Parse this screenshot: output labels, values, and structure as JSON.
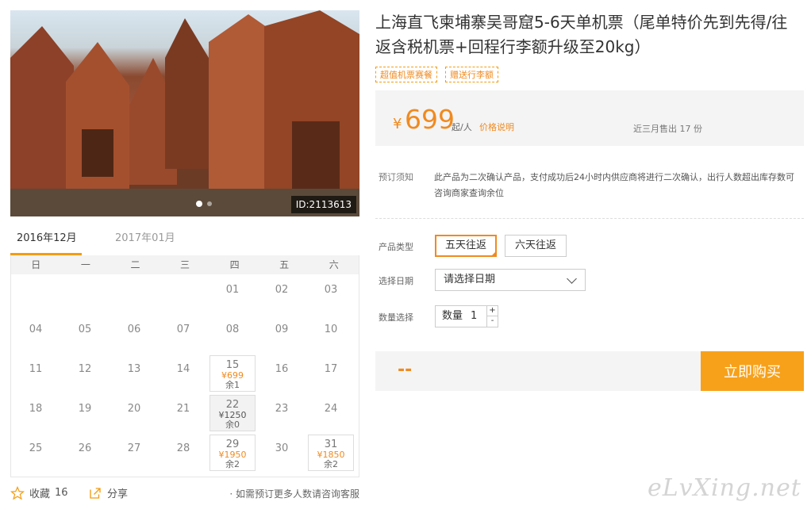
{
  "product": {
    "title": "上海直飞柬埔寨吴哥窟5-6天单机票（尾单特价先到先得/往返含税机票+回程行李额升级至20kg）",
    "tags": [
      "超值机票赛餐",
      "赠送行李额"
    ],
    "image_id": "ID:2113613"
  },
  "price": {
    "currency": "¥",
    "amount": "699",
    "unit": "起/人",
    "note_link": "价格说明",
    "sold": "近三月售出 17 份"
  },
  "notice": {
    "label": "预订须知",
    "text": "此产品为二次确认产品，支付成功后24小时内供应商将进行二次确认，出行人数超出库存数可咨询商家查询余位"
  },
  "options": {
    "type_label": "产品类型",
    "types": [
      "五天往返",
      "六天往返"
    ],
    "date_label": "选择日期",
    "date_placeholder": "请选择日期",
    "qty_label": "数量选择",
    "qty_field_label": "数量",
    "qty_value": "1",
    "plus": "+",
    "minus": "-"
  },
  "buy": {
    "total": "--",
    "button": "立即购买"
  },
  "calendar": {
    "tabs": [
      "2016年12月",
      "2017年01月"
    ],
    "weekdays": [
      "日",
      "一",
      "二",
      "三",
      "四",
      "五",
      "六"
    ],
    "weeks": [
      [
        null,
        null,
        null,
        null,
        {
          "d": "01"
        },
        {
          "d": "02"
        },
        {
          "d": "03"
        }
      ],
      [
        {
          "d": "04"
        },
        {
          "d": "05"
        },
        {
          "d": "06"
        },
        {
          "d": "07"
        },
        {
          "d": "08"
        },
        {
          "d": "09"
        },
        {
          "d": "10"
        }
      ],
      [
        {
          "d": "11"
        },
        {
          "d": "12"
        },
        {
          "d": "13"
        },
        {
          "d": "14"
        },
        {
          "d": "15",
          "p": "¥699",
          "r": "余1"
        },
        {
          "d": "16"
        },
        {
          "d": "17"
        }
      ],
      [
        {
          "d": "18"
        },
        {
          "d": "19"
        },
        {
          "d": "20"
        },
        {
          "d": "21"
        },
        {
          "d": "22",
          "p": "¥1250",
          "r": "余0",
          "dark": true
        },
        {
          "d": "23"
        },
        {
          "d": "24"
        }
      ],
      [
        {
          "d": "25"
        },
        {
          "d": "26"
        },
        {
          "d": "27"
        },
        {
          "d": "28"
        },
        {
          "d": "29",
          "p": "¥1950",
          "r": "余2"
        },
        {
          "d": "30"
        },
        {
          "d": "31",
          "p": "¥1850",
          "r": "余2"
        }
      ]
    ]
  },
  "footer": {
    "favorite_label": "收藏",
    "favorite_count": "16",
    "share_label": "分享",
    "note": "· 如需预订更多人数请咨询客服"
  },
  "watermark": "eLvXing.net",
  "colors": {
    "accent": "#f08a1f",
    "button": "#f7a11a"
  }
}
